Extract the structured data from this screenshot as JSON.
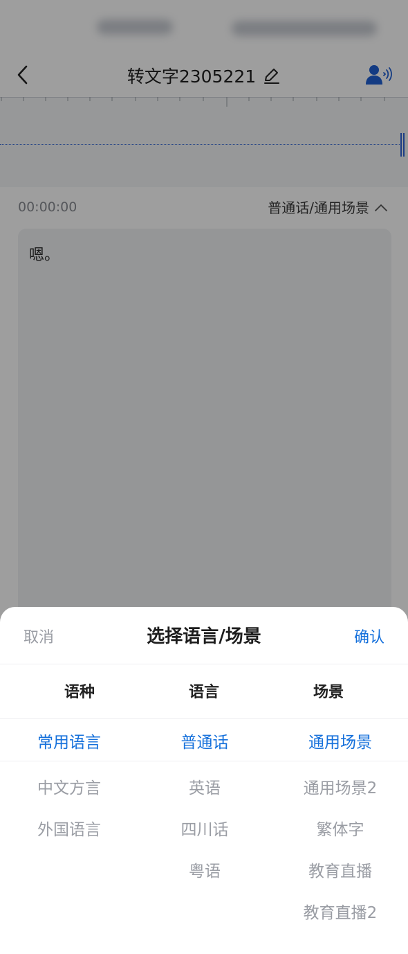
{
  "header": {
    "title": "转文字2305221",
    "back_icon": "chevron-left-icon",
    "edit_icon": "pencil-icon",
    "speaker_icon": "voice-speaker-icon"
  },
  "recording": {
    "time": "00:00:00",
    "language_scene": "普通话/通用场景"
  },
  "transcript": {
    "text": "嗯。"
  },
  "sheet": {
    "cancel": "取消",
    "title": "选择语言/场景",
    "confirm": "确认",
    "columns": {
      "kind": "语种",
      "language": "语言",
      "scene": "场景"
    },
    "kind_options": [
      "常用语言",
      "中文方言",
      "外国语言"
    ],
    "language_options": [
      "普通话",
      "英语",
      "四川话",
      "粤语"
    ],
    "scene_options": [
      "通用场景",
      "通用场景2",
      "繁体字",
      "教育直播",
      "教育直播2"
    ]
  },
  "colors": {
    "accent": "#1570db",
    "muted": "#9a9da4",
    "overlay": "rgba(0,0,0,0.38)"
  }
}
